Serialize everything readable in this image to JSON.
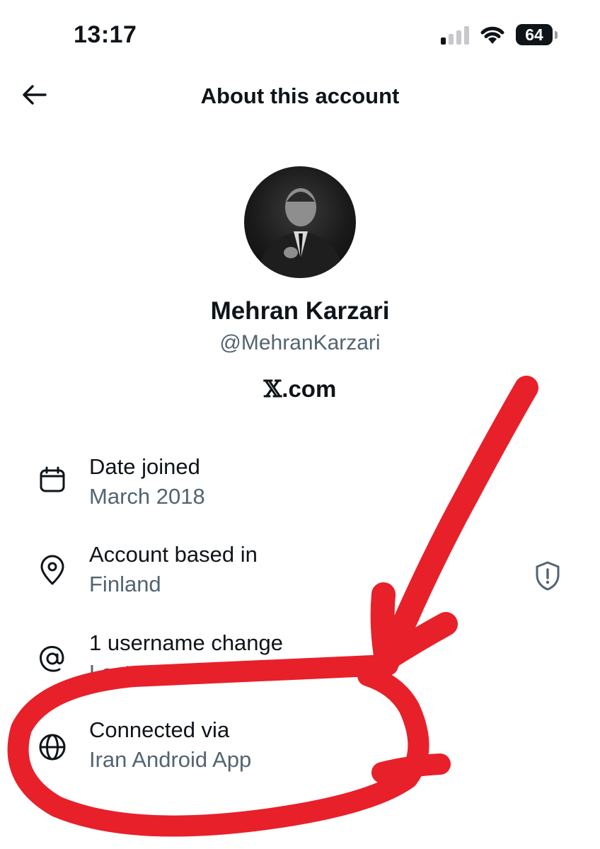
{
  "status_bar": {
    "time": "13:17",
    "battery": "64",
    "signal_bars_on": 1,
    "signal_bars_total": 4
  },
  "header": {
    "title": "About this account",
    "back_icon": "arrow-left-icon"
  },
  "profile": {
    "name": "Mehran Karzari",
    "handle": "@MehranKarzari",
    "site_glyph": "𝕏",
    "site_suffix": ".com"
  },
  "info": {
    "date_joined": {
      "icon": "calendar-icon",
      "label": "Date joined",
      "value": "March 2018"
    },
    "based_in": {
      "icon": "location-pin-icon",
      "label": "Account based in",
      "value": "Finland",
      "trailing_icon": "shield-alert-icon"
    },
    "username": {
      "icon": "at-sign-icon",
      "label": "1 username change",
      "value": "Last on March 2018"
    },
    "connected": {
      "icon": "globe-icon",
      "label": "Connected via",
      "value": "Iran Android App"
    }
  },
  "colors": {
    "text": "#0f1419",
    "secondary": "#536471",
    "annotation": "#e8202a"
  }
}
